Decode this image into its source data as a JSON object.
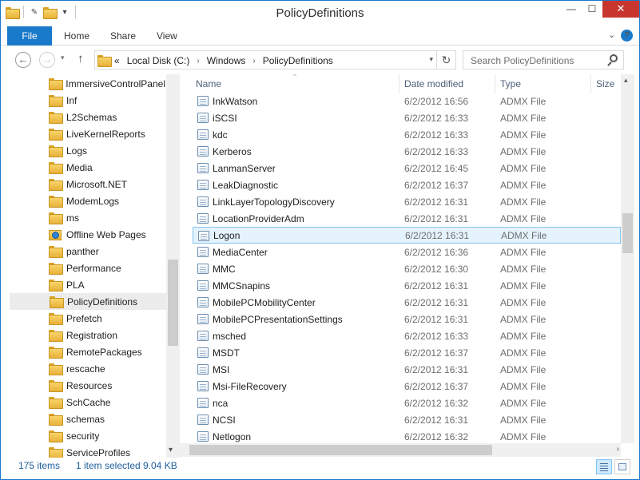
{
  "window": {
    "title": "PolicyDefinitions",
    "minimize": "—",
    "maximize": "☐",
    "close": "✕",
    "qat_undo": "✎",
    "qat_dropdown": "▾"
  },
  "ribbon": {
    "file_tab": "File",
    "tabs": [
      "Home",
      "Share",
      "View"
    ],
    "expand": "⌄",
    "help": "?"
  },
  "nav": {
    "back": "←",
    "forward": "→",
    "recent": "▾",
    "up": "↑",
    "crumb_prefix": "«",
    "crumbs": [
      "Local Disk (C:)",
      "Windows",
      "PolicyDefinitions"
    ],
    "crumb_sep": "›",
    "address_dropdown": "▾",
    "refresh": "↻",
    "search_placeholder": "Search PolicyDefinitions"
  },
  "tree": {
    "items": [
      {
        "label": "ImmersiveControlPanel",
        "icon": "folder-icon"
      },
      {
        "label": "Inf",
        "icon": "folder-icon"
      },
      {
        "label": "L2Schemas",
        "icon": "folder-icon"
      },
      {
        "label": "LiveKernelReports",
        "icon": "folder-icon"
      },
      {
        "label": "Logs",
        "icon": "folder-icon"
      },
      {
        "label": "Media",
        "icon": "folder-icon"
      },
      {
        "label": "Microsoft.NET",
        "icon": "folder-icon"
      },
      {
        "label": "ModemLogs",
        "icon": "folder-icon"
      },
      {
        "label": "ms",
        "icon": "folder-icon"
      },
      {
        "label": "Offline Web Pages",
        "icon": "offline-folder-icon"
      },
      {
        "label": "panther",
        "icon": "folder-icon"
      },
      {
        "label": "Performance",
        "icon": "folder-icon"
      },
      {
        "label": "PLA",
        "icon": "folder-icon"
      },
      {
        "label": "PolicyDefinitions",
        "icon": "folder-icon",
        "selected": true
      },
      {
        "label": "Prefetch",
        "icon": "folder-icon"
      },
      {
        "label": "Registration",
        "icon": "folder-icon"
      },
      {
        "label": "RemotePackages",
        "icon": "folder-icon"
      },
      {
        "label": "rescache",
        "icon": "folder-icon"
      },
      {
        "label": "Resources",
        "icon": "folder-icon"
      },
      {
        "label": "SchCache",
        "icon": "folder-icon"
      },
      {
        "label": "schemas",
        "icon": "folder-icon"
      },
      {
        "label": "security",
        "icon": "folder-icon"
      },
      {
        "label": "ServiceProfiles",
        "icon": "folder-icon"
      }
    ],
    "scroll_down": "▾"
  },
  "list": {
    "columns": {
      "name": "Name",
      "date": "Date modified",
      "type": "Type",
      "size": "Size"
    },
    "sort_indicator": "^",
    "rows": [
      {
        "name": "InkWatson",
        "date": "6/2/2012 16:56",
        "type": "ADMX File"
      },
      {
        "name": "iSCSI",
        "date": "6/2/2012 16:33",
        "type": "ADMX File"
      },
      {
        "name": "kdc",
        "date": "6/2/2012 16:33",
        "type": "ADMX File"
      },
      {
        "name": "Kerberos",
        "date": "6/2/2012 16:33",
        "type": "ADMX File"
      },
      {
        "name": "LanmanServer",
        "date": "6/2/2012 16:45",
        "type": "ADMX File"
      },
      {
        "name": "LeakDiagnostic",
        "date": "6/2/2012 16:37",
        "type": "ADMX File"
      },
      {
        "name": "LinkLayerTopologyDiscovery",
        "date": "6/2/2012 16:31",
        "type": "ADMX File"
      },
      {
        "name": "LocationProviderAdm",
        "date": "6/2/2012 16:31",
        "type": "ADMX File"
      },
      {
        "name": "Logon",
        "date": "6/2/2012 16:31",
        "type": "ADMX File",
        "selected": true
      },
      {
        "name": "MediaCenter",
        "date": "6/2/2012 16:36",
        "type": "ADMX File"
      },
      {
        "name": "MMC",
        "date": "6/2/2012 16:30",
        "type": "ADMX File"
      },
      {
        "name": "MMCSnapins",
        "date": "6/2/2012 16:31",
        "type": "ADMX File"
      },
      {
        "name": "MobilePCMobilityCenter",
        "date": "6/2/2012 16:31",
        "type": "ADMX File"
      },
      {
        "name": "MobilePCPresentationSettings",
        "date": "6/2/2012 16:31",
        "type": "ADMX File"
      },
      {
        "name": "msched",
        "date": "6/2/2012 16:33",
        "type": "ADMX File"
      },
      {
        "name": "MSDT",
        "date": "6/2/2012 16:37",
        "type": "ADMX File"
      },
      {
        "name": "MSI",
        "date": "6/2/2012 16:31",
        "type": "ADMX File"
      },
      {
        "name": "Msi-FileRecovery",
        "date": "6/2/2012 16:37",
        "type": "ADMX File"
      },
      {
        "name": "nca",
        "date": "6/2/2012 16:32",
        "type": "ADMX File"
      },
      {
        "name": "NCSI",
        "date": "6/2/2012 16:31",
        "type": "ADMX File"
      },
      {
        "name": "Netlogon",
        "date": "6/2/2012 16:32",
        "type": "ADMX File"
      }
    ],
    "scroll_up": "▴",
    "scroll_right": "›"
  },
  "status": {
    "item_count": "175 items",
    "selection": "1 item selected",
    "size": "9.04 KB"
  },
  "colors": {
    "accent": "#1979ca",
    "selection_bg": "#e5f3ff",
    "selection_border": "#84c4f5",
    "close_red": "#c7372f"
  }
}
